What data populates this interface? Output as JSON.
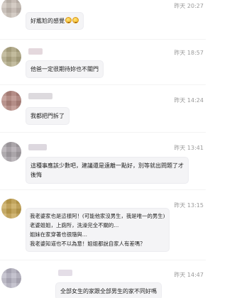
{
  "comments": [
    {
      "time": "昨天 20:27",
      "lines": [
        "好尷尬的感覺"
      ],
      "emoji": [
        "grinning-sweat-emoji",
        "grinning-sweat-emoji"
      ]
    },
    {
      "time": "昨天 18:57",
      "lines": [
        "他爸一定很期待妳也不關門"
      ]
    },
    {
      "time": "昨天 14:24",
      "lines": [
        "我都把門拆了"
      ]
    },
    {
      "time": "昨天 13:41",
      "lines": [
        "這種事應該少數吧，建議還是遠離一點好，別等就出問題了才",
        "後悔"
      ]
    },
    {
      "time": "昨天 13:15",
      "lines": [
        "我老婆家也是這樣阿！(可能他家沒男生，我是唯一的男生)",
        "老婆姐姐，上廁所，洗澡完全不關的...",
        "姐妹在家穿著也很隨與...",
        "我老婆知道也不以為意！姐姐都說自家人有差嗎？"
      ]
    },
    {
      "time": "昨天 14:47",
      "lines": [
        "全部女生的家跟全部男生的家不同好嗎"
      ]
    }
  ],
  "colors": {
    "bubble_bg": "#f4f4f6",
    "time_text": "#9a9a9a"
  }
}
